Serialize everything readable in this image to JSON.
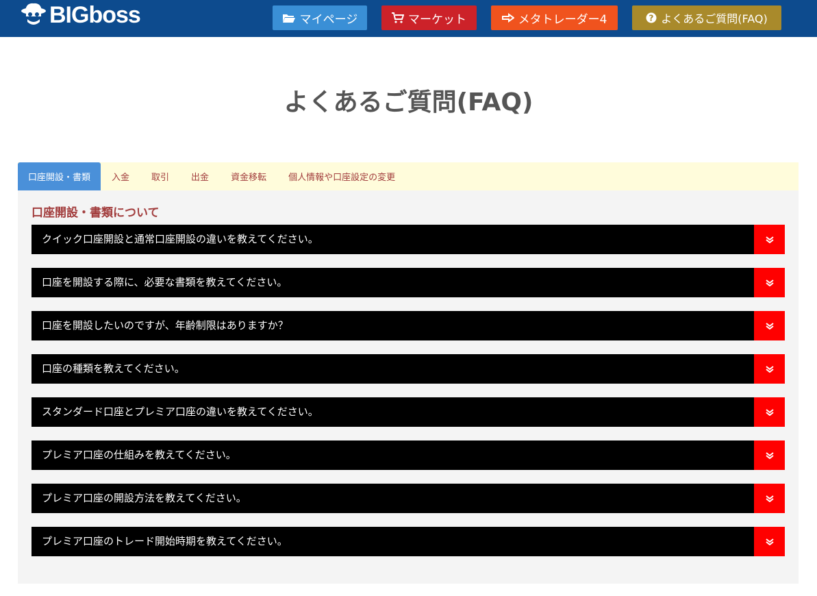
{
  "header": {
    "logo_text": "BIGboss",
    "nav": [
      {
        "label": "マイページ",
        "icon": "folder-open-icon",
        "color": "#3a8fd6"
      },
      {
        "label": "マーケット",
        "icon": "shopping-cart-icon",
        "color": "#cc2229"
      },
      {
        "label": "メタトレーダー4",
        "icon": "hand-point-icon",
        "color": "#f0531e"
      },
      {
        "label": "よくあるご質問(FAQ)",
        "icon": "question-circle-icon",
        "color": "#a98a2b"
      }
    ]
  },
  "page_title": "よくあるご質問(FAQ)",
  "tabs": [
    {
      "label": "口座開設・書類",
      "active": true
    },
    {
      "label": "入金",
      "active": false
    },
    {
      "label": "取引",
      "active": false
    },
    {
      "label": "出金",
      "active": false
    },
    {
      "label": "資金移転",
      "active": false
    },
    {
      "label": "個人情報や口座設定の変更",
      "active": false
    }
  ],
  "section_title": "口座開設・書類について",
  "faqs": [
    "クイック口座開設と通常口座開設の違いを教えてください。",
    "口座を開設する際に、必要な書類を教えてください。",
    "口座を開設したいのですが、年齢制限はありますか？",
    "口座の種類を教えてください。",
    "スタンダード口座とプレミア口座の違いを教えてください。",
    "プレミア口座の仕組みを教えてください。",
    "プレミア口座の開設方法を教えてください。",
    "プレミア口座のトレード開始時期を教えてください。"
  ],
  "colors": {
    "topbar": "#0d4b8e",
    "accent_red": "#ff0000",
    "section_title": "#a23d3d",
    "active_tab": "#4a90d9"
  }
}
